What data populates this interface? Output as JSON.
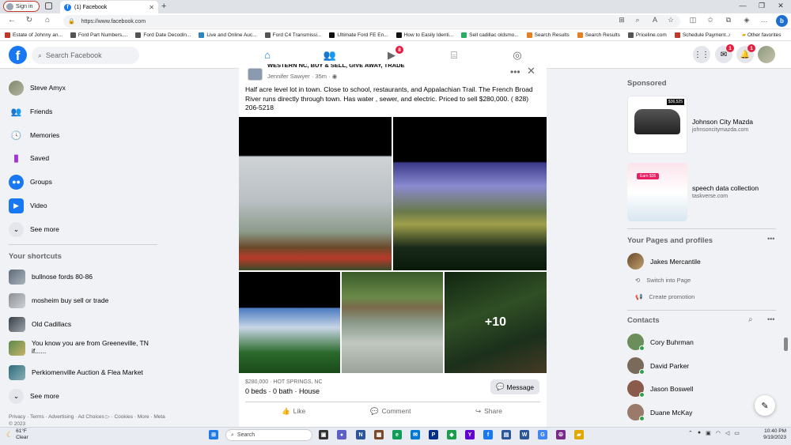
{
  "browser": {
    "signin_label": "Sign in",
    "tab_title": "(1) Facebook",
    "url": "https://www.facebook.com",
    "bookmarks": [
      {
        "label": "Estate of Johnny an...",
        "color": "#c0392b"
      },
      {
        "label": "Ford Part Numbers,...",
        "color": "#555555"
      },
      {
        "label": "Ford Date Decodin...",
        "color": "#555555"
      },
      {
        "label": "Live and Online Auc...",
        "color": "#2e86c1"
      },
      {
        "label": "Ford C4 Transmissi...",
        "color": "#555555"
      },
      {
        "label": "Ultimate Ford FE En...",
        "color": "#111111"
      },
      {
        "label": "How to Easily Identi...",
        "color": "#111111"
      },
      {
        "label": "Sell cadillac oldsmo...",
        "color": "#27ae60"
      },
      {
        "label": "Search Results",
        "color": "#e67e22"
      },
      {
        "label": "Search Results",
        "color": "#e67e22"
      },
      {
        "label": "Priceline.com",
        "color": "#555555"
      },
      {
        "label": "Schedule Payment...",
        "color": "#c0392b"
      }
    ],
    "other_favorites": "Other favorites"
  },
  "header": {
    "search_placeholder": "Search Facebook",
    "watch_badge": "8",
    "messenger_badge": "1",
    "notifications_badge": "1"
  },
  "sidebar": {
    "items": [
      {
        "label": "Steve Amyx",
        "icon": "avatar"
      },
      {
        "label": "Friends",
        "icon": "friends-icon"
      },
      {
        "label": "Memories",
        "icon": "clock-icon"
      },
      {
        "label": "Saved",
        "icon": "bookmark-icon"
      },
      {
        "label": "Groups",
        "icon": "groups-icon"
      },
      {
        "label": "Video",
        "icon": "video-icon"
      },
      {
        "label": "See more",
        "icon": "chevron-down-icon"
      }
    ],
    "shortcuts_title": "Your shortcuts",
    "shortcuts": [
      {
        "label": "bullnose fords 80-86"
      },
      {
        "label": "mosheim buy sell or trade"
      },
      {
        "label": "Old Cadillacs"
      },
      {
        "label": "You know you are from Greeneville, TN if......"
      },
      {
        "label": "Perkiomenville Auction & Flea Market"
      }
    ],
    "see_more_2": "See more",
    "footer": "Privacy · Terms · Advertising · Ad Choices ▷ · Cookies · More · Meta © 2023"
  },
  "post": {
    "group_title": "WESTERN NC, BUY & SELL, GIVE AWAY, TRADE",
    "author": "Jennifer Sawyer · 35m · ◉",
    "body": "Half acre level lot in town. Close to school, restaurants,  and Appalachian Trail. The French Broad River runs directly through town. Has water , sewer, and electric. Priced to sell $280,000. ( 828) 206-5218",
    "more_photos": "+10",
    "price_location": "$280,000 · HOT SPRINGS, NC",
    "listing_details": "0 beds · 0 bath · House",
    "message_label": "Message",
    "like_label": "Like",
    "comment_label": "Comment",
    "share_label": "Share"
  },
  "right": {
    "sponsored_title": "Sponsored",
    "ads": [
      {
        "title": "Johnson City Mazda",
        "domain": "johnsoncitymazda.com",
        "tag": "$36,525"
      },
      {
        "title": "speech data collection",
        "domain": "taskverse.com",
        "tag": "Earn $35"
      }
    ],
    "pages_title": "Your Pages and profiles",
    "page_name": "Jakes Mercantile",
    "switch_label": "Switch into Page",
    "promo_label": "Create promotion",
    "contacts_title": "Contacts",
    "contacts": [
      {
        "name": "Cory Buhrman",
        "color": "#6b8e5a"
      },
      {
        "name": "David Parker",
        "color": "#7a6a5a"
      },
      {
        "name": "Jason Boswell",
        "color": "#8a5a4a"
      },
      {
        "name": "Duane McKay",
        "color": "#9a7a6a"
      }
    ]
  },
  "taskbar": {
    "temp": "61°F",
    "condition": "Clear",
    "search_label": "Search",
    "time": "10:40 PM",
    "date": "9/19/2023"
  }
}
